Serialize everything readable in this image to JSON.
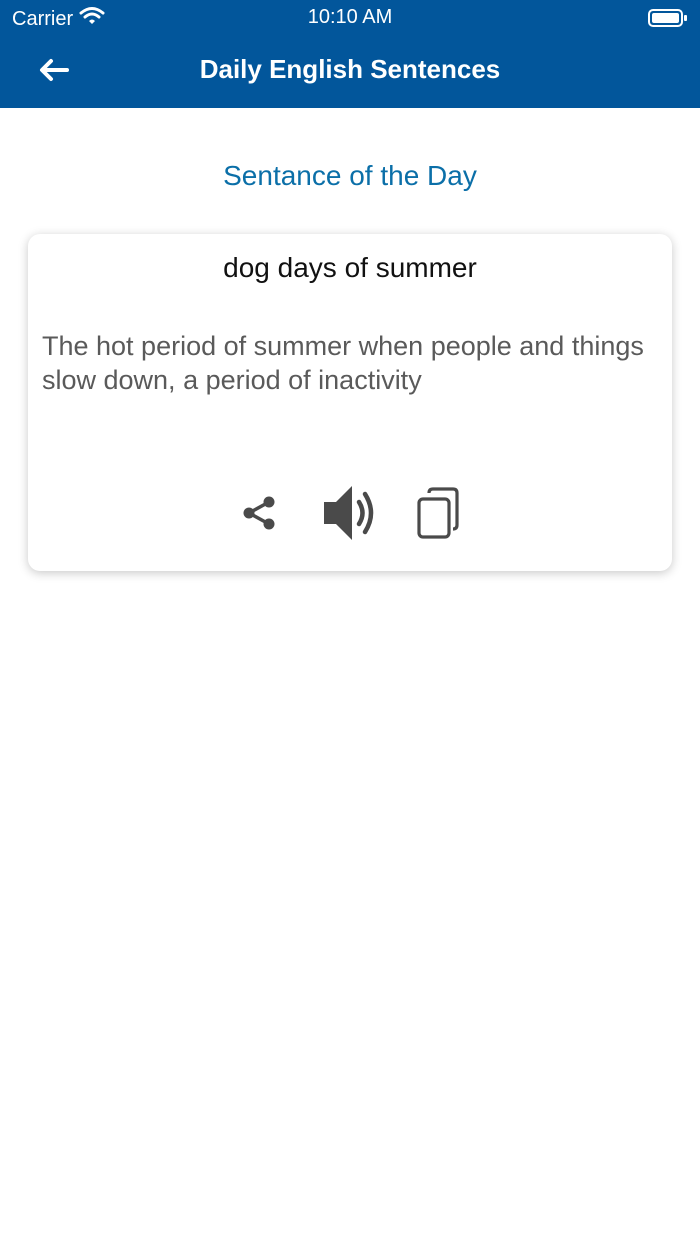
{
  "status_bar": {
    "carrier": "Carrier",
    "time": "10:10 AM"
  },
  "nav": {
    "title": "Daily English Sentences",
    "back_icon": "arrow-left-icon"
  },
  "section_title": "Sentance of the Day",
  "card": {
    "phrase": "dog days of summer",
    "meaning": "The hot period of summer when people and things slow down, a period of inactivity",
    "actions": [
      {
        "name": "share",
        "icon": "share-icon"
      },
      {
        "name": "speak",
        "icon": "speaker-icon"
      },
      {
        "name": "copy",
        "icon": "copy-icon"
      }
    ]
  },
  "colors": {
    "header": "#02569b",
    "accent_text": "#0b6fa8",
    "icon": "#4a4a4a"
  }
}
